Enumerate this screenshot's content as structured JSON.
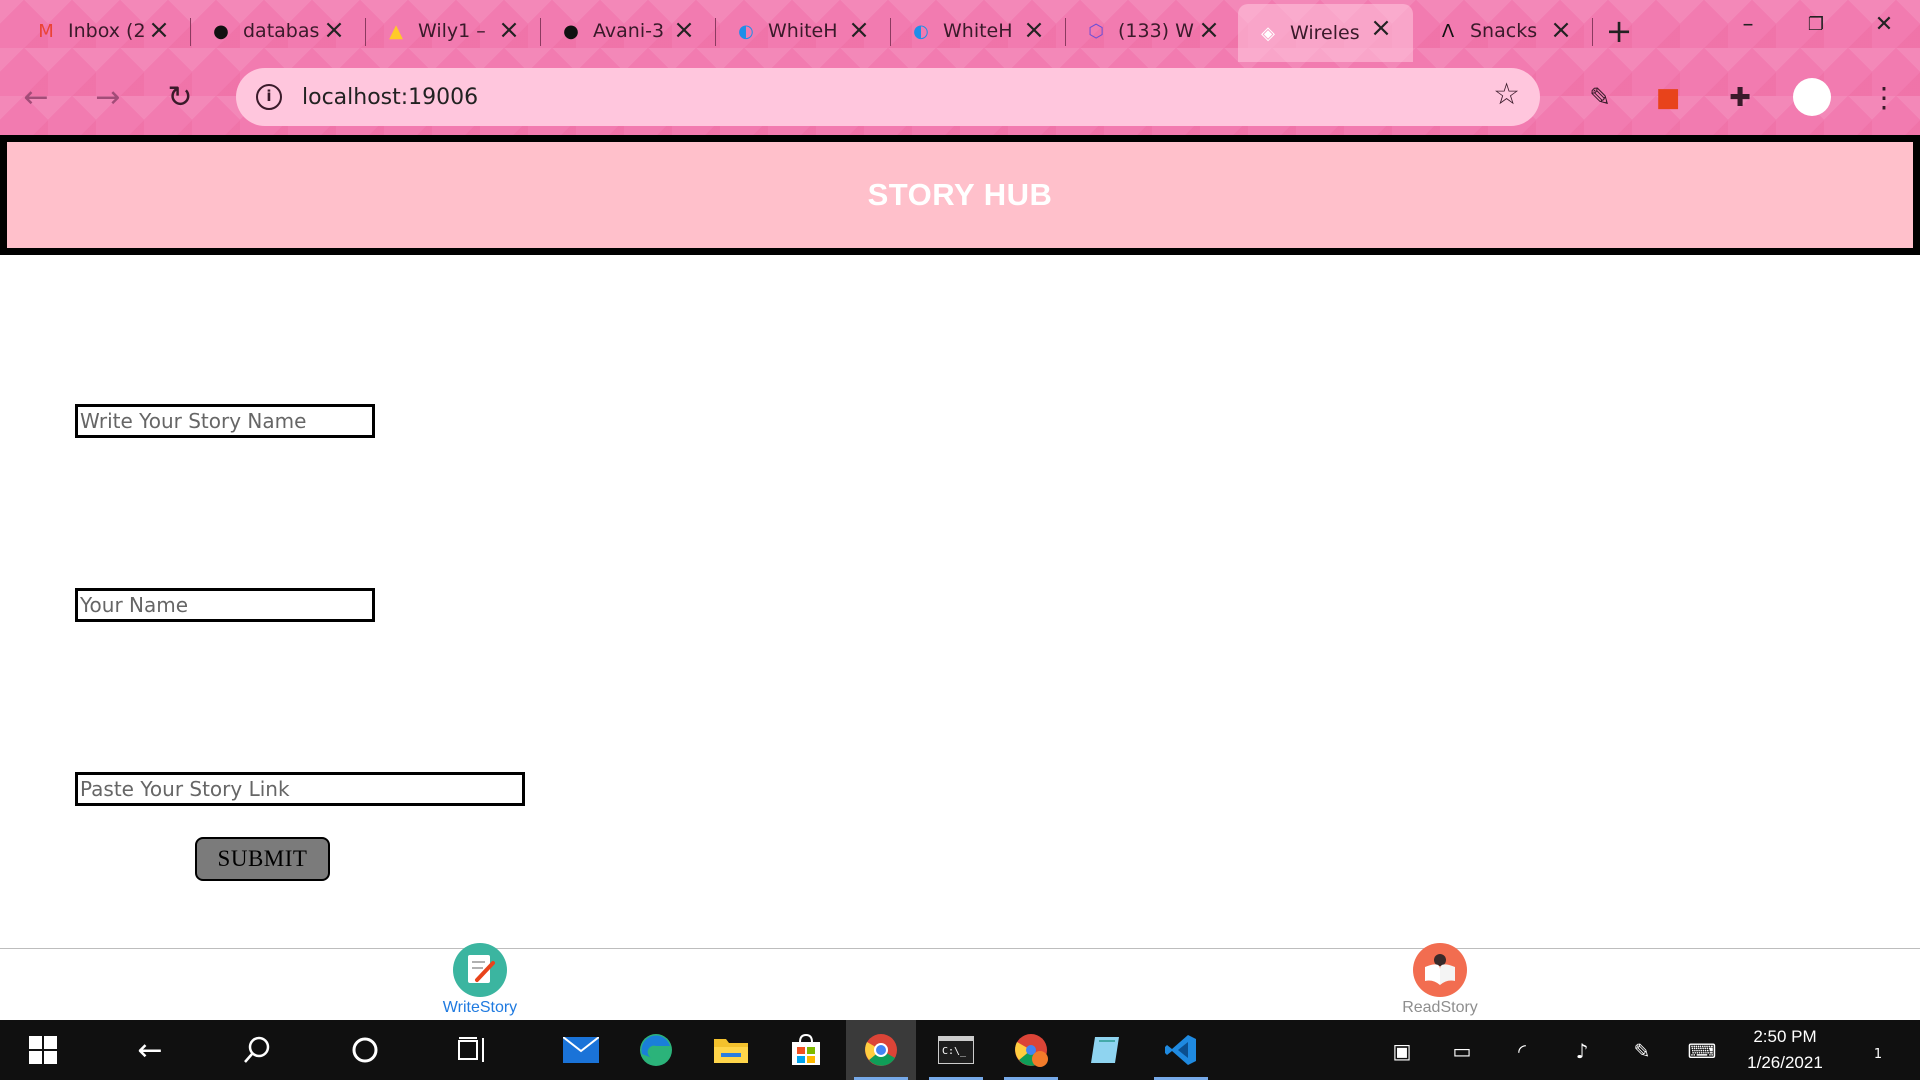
{
  "browser": {
    "tabs": [
      {
        "title": "Inbox (2",
        "icon": "gmail-icon",
        "glyph": "M",
        "color": "#ea4335"
      },
      {
        "title": "databas",
        "icon": "github-icon",
        "glyph": "●",
        "color": "#111111"
      },
      {
        "title": "Wily1 –",
        "icon": "firebase-icon",
        "glyph": "▲",
        "color": "#ffca28"
      },
      {
        "title": "Avani-3",
        "icon": "github-icon",
        "glyph": "●",
        "color": "#111111"
      },
      {
        "title": "WhiteH",
        "icon": "whitehat-icon",
        "glyph": "◐",
        "color": "#1f8ee8"
      },
      {
        "title": "WhiteH",
        "icon": "whitehat-icon",
        "glyph": "◐",
        "color": "#1f8ee8"
      },
      {
        "title": "(133) W",
        "icon": "app-icon",
        "glyph": "⬡",
        "color": "#6b4fd6"
      },
      {
        "title": "Wireles",
        "icon": "expo-icon",
        "glyph": "◈",
        "color": "#ffffff"
      },
      {
        "title": "Snacks",
        "icon": "expo-snack-icon",
        "glyph": "Λ",
        "color": "#111111"
      }
    ],
    "active_tab_index": 7,
    "url": "localhost:19006"
  },
  "app": {
    "title": "STORY HUB",
    "fields": {
      "story_name_placeholder": "Write Your Story Name",
      "author_placeholder": "Your Name",
      "story_link_placeholder": "Paste Your Story Link"
    },
    "submit_label": "SUBMIT",
    "bottom_nav": {
      "write": {
        "label": "WriteStory",
        "color": "#1f7ae0"
      },
      "read": {
        "label": "ReadStory",
        "color": "#8e8e8e"
      }
    }
  },
  "taskbar": {
    "time": "2:50 PM",
    "date": "1/26/2021",
    "notification_count": "1"
  }
}
